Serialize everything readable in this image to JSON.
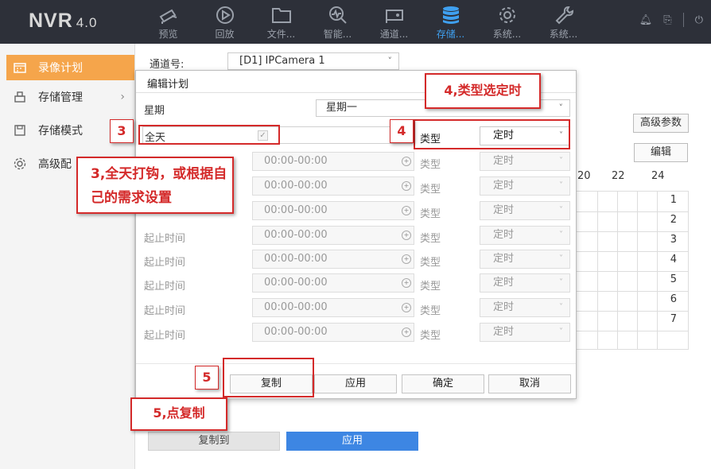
{
  "app": {
    "name": "NVR",
    "version": "4.0"
  },
  "nav": [
    {
      "label": "预览",
      "icon": "camera-icon"
    },
    {
      "label": "回放",
      "icon": "playback-icon"
    },
    {
      "label": "文件...",
      "icon": "folder-icon"
    },
    {
      "label": "智能...",
      "icon": "smart-icon"
    },
    {
      "label": "通道...",
      "icon": "channel-icon"
    },
    {
      "label": "存储...",
      "icon": "storage-icon",
      "active": true
    },
    {
      "label": "系统...",
      "icon": "gear-icon"
    },
    {
      "label": "系统...",
      "icon": "wrench-icon"
    }
  ],
  "sidebar": {
    "items": [
      {
        "label": "录像计划",
        "icon": "calendar-icon"
      },
      {
        "label": "存储管理",
        "icon": "storage-manage-icon"
      },
      {
        "label": "存储模式",
        "icon": "save-icon"
      },
      {
        "label": "高级配",
        "icon": "settings-icon"
      }
    ]
  },
  "main": {
    "channel_label": "通道号:",
    "channel_value": "[D1] IPCamera 1",
    "advanced_button": "高级参数",
    "edit_button": "编辑",
    "hours": [
      "20",
      "22",
      "24"
    ],
    "days": [
      "1",
      "2",
      "3",
      "4",
      "5",
      "6",
      "7"
    ],
    "copy_to_button": "复制到",
    "apply_button": "应用"
  },
  "dialog": {
    "title": "编辑计划",
    "week_label": "星期",
    "week_value": "星期一",
    "all_day_label": "全天",
    "all_day_checked": true,
    "type_label": "类型",
    "type_value": "定时",
    "rows": [
      {
        "label": "",
        "time": "00:00-00:00",
        "type_label": "类型",
        "type_value": "定时"
      },
      {
        "label": "",
        "time": "00:00-00:00",
        "type_label": "类型",
        "type_value": "定时"
      },
      {
        "label": "",
        "time": "00:00-00:00",
        "type_label": "类型",
        "type_value": "定时"
      },
      {
        "label": "起止时间",
        "time": "00:00-00:00",
        "type_label": "类型",
        "type_value": "定时"
      },
      {
        "label": "起止时间",
        "time": "00:00-00:00",
        "type_label": "类型",
        "type_value": "定时"
      },
      {
        "label": "起止时间",
        "time": "00:00-00:00",
        "type_label": "类型",
        "type_value": "定时"
      },
      {
        "label": "起止时间",
        "time": "00:00-00:00",
        "type_label": "类型",
        "type_value": "定时"
      },
      {
        "label": "起止时间",
        "time": "00:00-00:00",
        "type_label": "类型",
        "type_value": "定时"
      }
    ],
    "buttons": {
      "copy": "复制",
      "apply": "应用",
      "ok": "确定",
      "cancel": "取消"
    }
  },
  "annotations": {
    "tag3": "3",
    "tag4": "4",
    "tag5": "5",
    "note3": "3,全天打钩，或根据自己的需求设置",
    "note4": "4,类型选定时",
    "note5": "5,点复制"
  }
}
